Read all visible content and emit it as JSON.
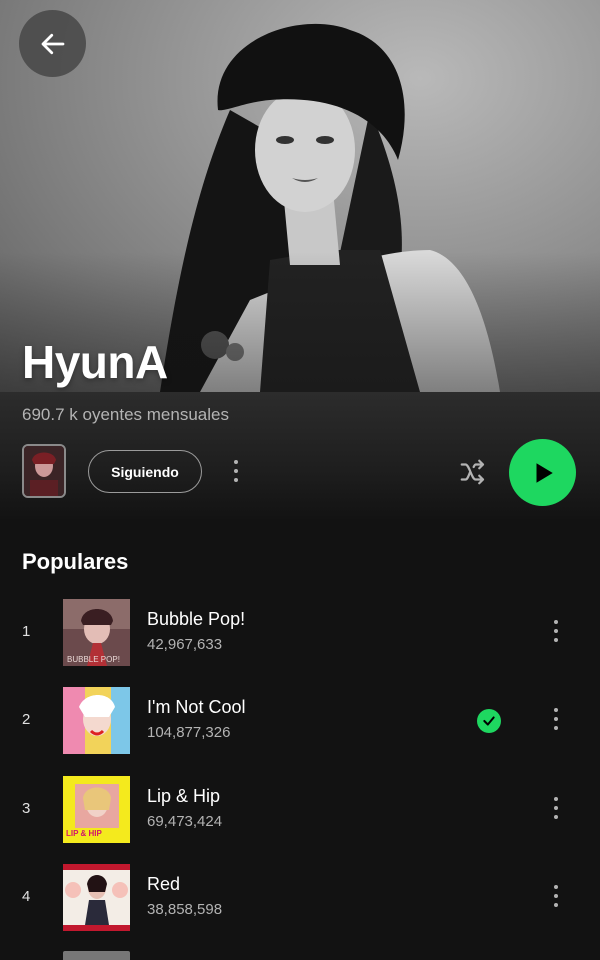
{
  "artist": {
    "name": "HyunA",
    "monthly_listeners": "690.7 k oyentes mensuales"
  },
  "actions": {
    "follow_label": "Siguiendo"
  },
  "section": {
    "title": "Populares"
  },
  "tracks": [
    {
      "number": "1",
      "title": "Bubble Pop!",
      "plays": "42,967,633",
      "liked": false,
      "art_text": "BUBBLE POP!"
    },
    {
      "number": "2",
      "title": "I'm Not Cool",
      "plays": "104,877,326",
      "liked": true
    },
    {
      "number": "3",
      "title": "Lip & Hip",
      "plays": "69,473,424",
      "liked": false,
      "art_text": "LIP & HIP"
    },
    {
      "number": "4",
      "title": "Red",
      "plays": "38,858,598",
      "liked": false
    }
  ],
  "colors": {
    "accent": "#1ed760",
    "background": "#121212",
    "secondary_text": "#b3b3b3"
  },
  "icons": {
    "back": "arrow-left-icon",
    "shuffle": "shuffle-icon",
    "play": "play-icon",
    "more": "more-vertical-icon",
    "liked": "check-circle-icon"
  }
}
